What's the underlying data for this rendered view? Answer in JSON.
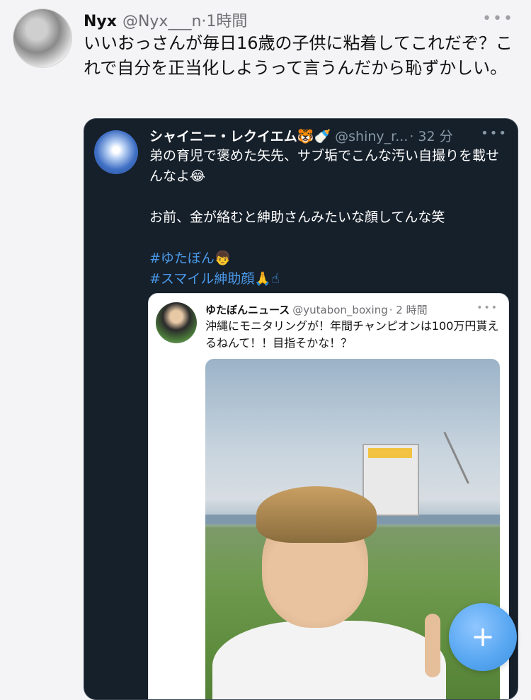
{
  "tweet": {
    "name": "Nyx",
    "handle": "@Nyx___n",
    "time": "·1時間",
    "more": "•••",
    "text": "いいおっさんが毎日16歳の子供に粘着してこれだぞ？これで自分を正当化しようって言うんだから恥ずかしい。"
  },
  "quote1": {
    "name": "シャイニー・レクイエム🐯🍼",
    "handle": "@shiny_r...",
    "time": "· 32 分",
    "more": "•••",
    "text1": "弟の育児で褒めた矢先、サブ垢でこんな汚い自撮りを載せんなよ😂",
    "text2": "お前、金が絡むと紳助さんみたいな顔してんな笑",
    "hashtag1": "#ゆたぼん👦",
    "hashtag2": "#スマイル紳助顔🙏☝"
  },
  "quote2": {
    "name": "ゆたぼんニュース",
    "handle": "@yutabon_boxing",
    "time": "· 2 時間",
    "more": "•••",
    "text": "沖縄にモニタリングが！年間チャンピオンは100万円貰えるねんて！！目指そかな！？"
  },
  "fab": {
    "label": "+",
    "icon": "plus-icon"
  }
}
